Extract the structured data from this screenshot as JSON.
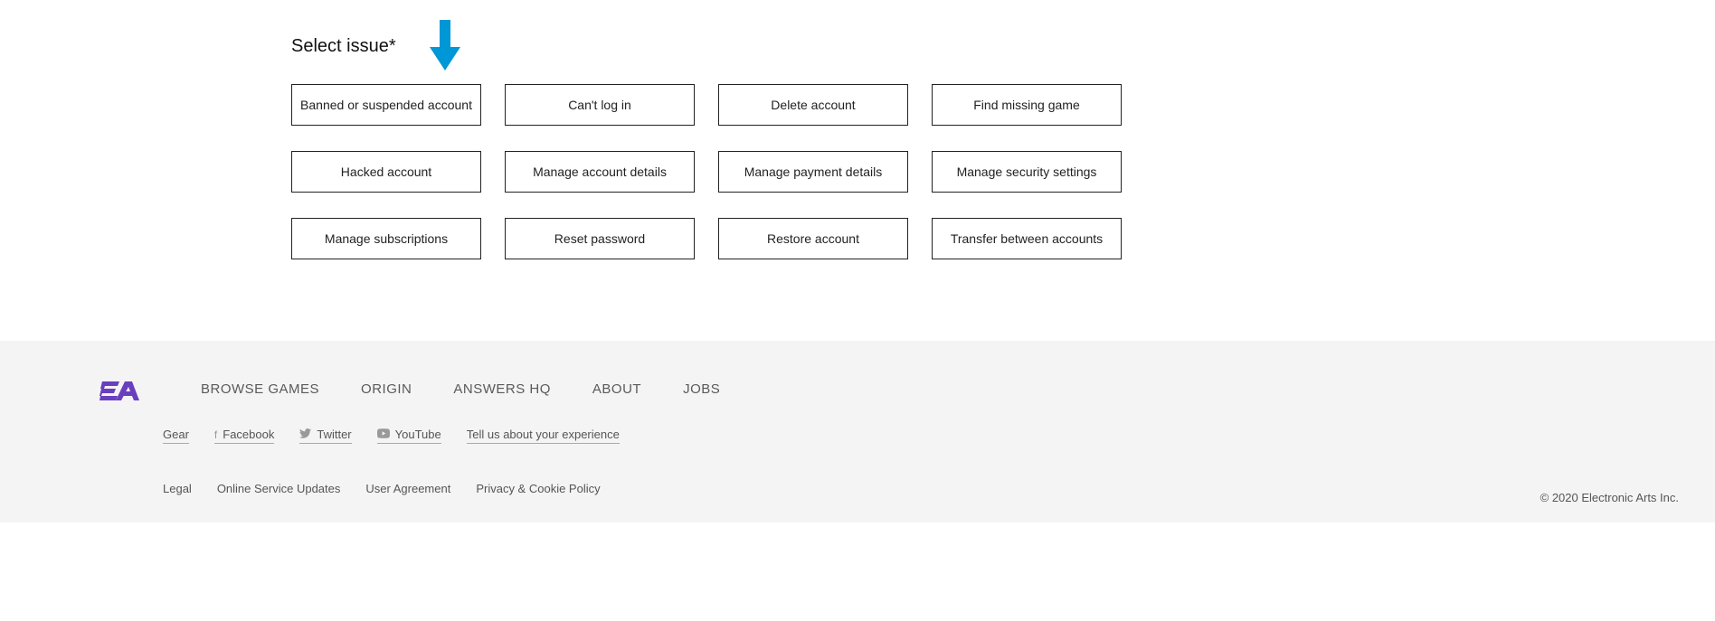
{
  "heading": "Select issue*",
  "issues": [
    "Banned or suspended account",
    "Can't log in",
    "Delete account",
    "Find missing game",
    "Hacked account",
    "Manage account details",
    "Manage payment details",
    "Manage security settings",
    "Manage subscriptions",
    "Reset password",
    "Restore account",
    "Transfer between accounts"
  ],
  "footer": {
    "nav": [
      "BROWSE GAMES",
      "ORIGIN",
      "ANSWERS HQ",
      "ABOUT",
      "JOBS"
    ],
    "social": {
      "gear": "Gear",
      "facebook": "Facebook",
      "twitter": "Twitter",
      "youtube": "YouTube",
      "feedback": "Tell us about your experience"
    },
    "legal": [
      "Legal",
      "Online Service Updates",
      "User Agreement",
      "Privacy & Cookie Policy"
    ],
    "copyright": "© 2020 Electronic Arts Inc."
  }
}
